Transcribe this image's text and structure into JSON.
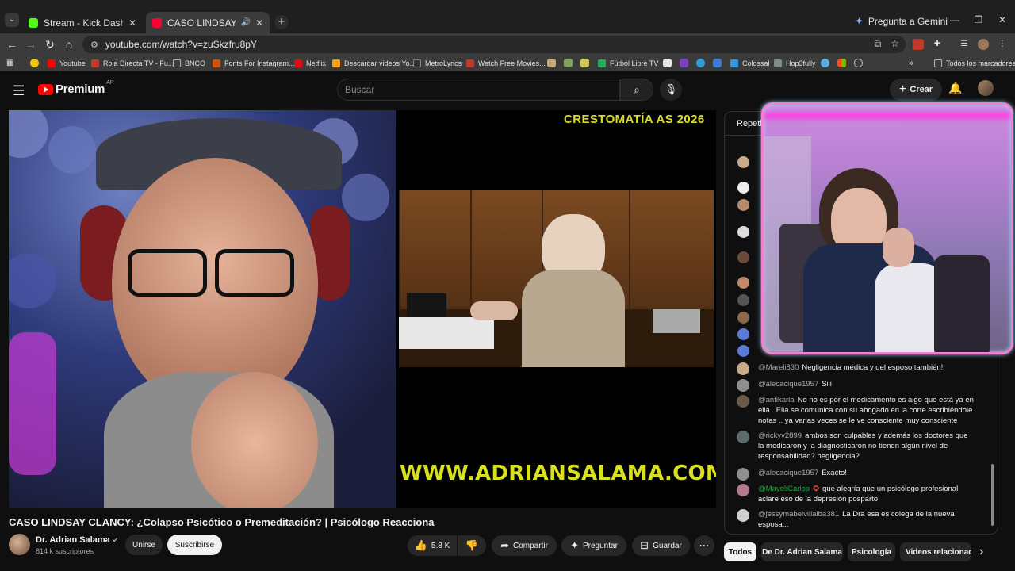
{
  "browser": {
    "tabs": [
      {
        "label": "Stream - Kick Dashboard",
        "color": "#53fc18"
      },
      {
        "label": "CASO LINDSAY CLANCY: ¿",
        "color": "#ff0033"
      }
    ],
    "gemini_label": "Pregunta a Gemini",
    "url": "youtube.com/watch?v=zuSkzfru8pY",
    "bookmarks": [
      {
        "label": "Youtube",
        "color": "#ff0000"
      },
      {
        "label": "Roja Directa TV - Fu...",
        "color": "#c0392b"
      },
      {
        "label": "BNCO",
        "color": "#9aa0a6"
      },
      {
        "label": "Fonts For Instagram...",
        "color": "#d35400"
      },
      {
        "label": "Netflix",
        "color": "#e50914"
      },
      {
        "label": "Descargar videos Yo...",
        "color": "#f39c12"
      },
      {
        "label": "MetroLyrics",
        "color": "#333333"
      },
      {
        "label": "Watch Free Movies...",
        "color": "#c0392b"
      },
      {
        "label": "Fútbol Libre TV",
        "color": "#27ae60"
      },
      {
        "label": "Colossal",
        "color": "#3498db"
      },
      {
        "label": "Hop3fully",
        "color": "#7f8c8d"
      }
    ],
    "bookmarks_all": "Todos los marcadores"
  },
  "youtube": {
    "brand": "Premium",
    "country": "AR",
    "search_placeholder": "Buscar",
    "create_label": "Crear"
  },
  "video": {
    "overlay_top_text": "CRESTOMATÍA AS 2026",
    "overlay_bottom_text": "WWW.ADRIANSALAMA.COM",
    "title": "CASO LINDSAY CLANCY: ¿Colapso Psicótico o Premeditación? | Psicólogo Reacciona",
    "channel": "Dr. Adrian Salama",
    "subscribers": "814 k suscriptores",
    "join_label": "Unirse",
    "subscribe_label": "Suscribirse",
    "likes": "5.8 K",
    "share_label": "Compartir",
    "ask_label": "Preguntar",
    "save_label": "Guardar"
  },
  "chat": {
    "header": "Repeti",
    "messages": [
      {
        "author": "@Mareli830",
        "text": "Negligencia médica y del esposo también!",
        "color": "#c9a98a"
      },
      {
        "author": "@alecacique1957",
        "text": "Siii",
        "color": "#8e8e8e"
      },
      {
        "author": "@antikarla",
        "text": "No no es por el medicamento es algo que está ya en ella . Ella se comunica con su abogado en la corte escribiéndole notas .. ya varias veces se le ve consciente muy consciente",
        "color": "#6b5a4a"
      },
      {
        "author": "@rickyv2899",
        "text": "ambos son culpables y además los doctores que la medicaron y la diagnosticaron no tienen algún nivel de responsabilidad? negligencia?",
        "color": "#5e6b6e"
      },
      {
        "author": "@alecacique1957",
        "text": "Exacto!",
        "color": "#8e8e8e"
      },
      {
        "author": "@MayeliCarlop",
        "text": "que alegría que un psicólogo profesional aclare eso de la depresión posparto",
        "color": "#b07a8a",
        "moderator": true
      },
      {
        "author": "@jessymabelvillalba381",
        "text": "La Dra esa es colega de la nueva esposa...",
        "color": "#d0d0d0"
      }
    ]
  },
  "chips": [
    "Todos",
    "De Dr. Adrian Salama",
    "Psicología",
    "Videos relacionados"
  ]
}
